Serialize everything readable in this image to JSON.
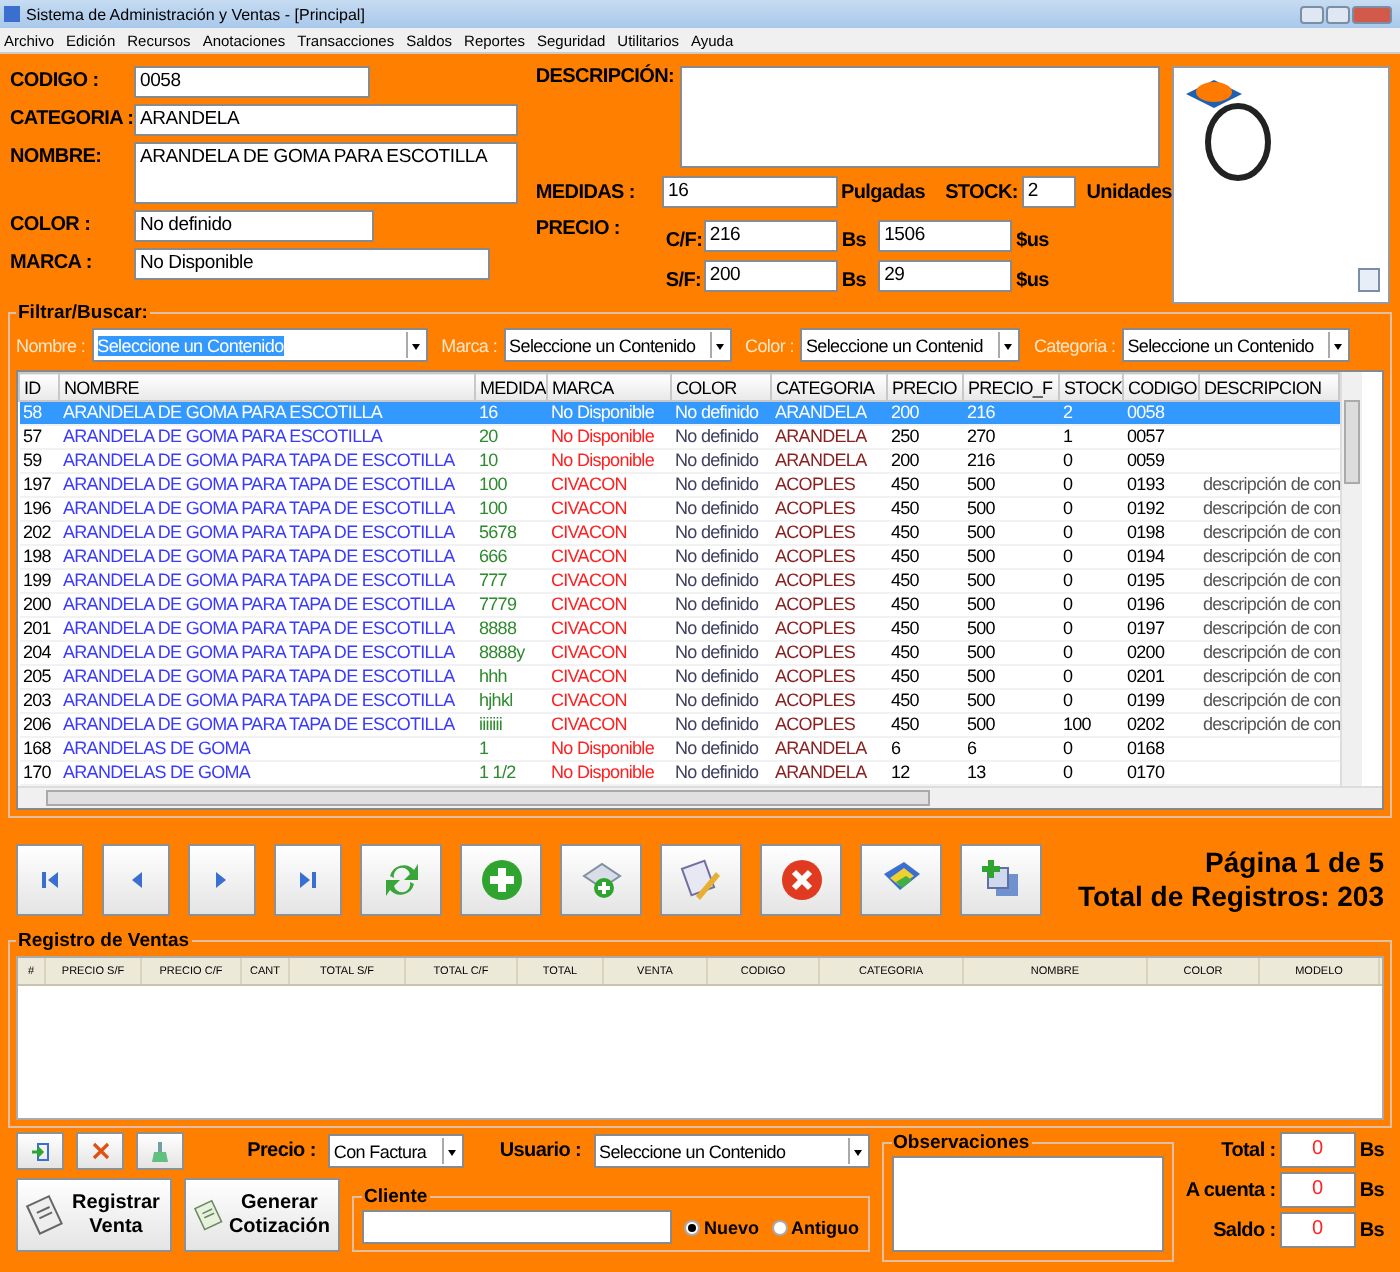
{
  "window": {
    "title": "Sistema de Administración y Ventas - [Principal]"
  },
  "menu": [
    "Archivo",
    "Edición",
    "Recursos",
    "Anotaciones",
    "Transacciones",
    "Saldos",
    "Reportes",
    "Seguridad",
    "Utilitarios",
    "Ayuda"
  ],
  "product": {
    "codigo": {
      "label": "CODIGO :",
      "value": "0058"
    },
    "categoria": {
      "label": "CATEGORIA :",
      "value": "ARANDELA"
    },
    "nombre": {
      "label": "NOMBRE:",
      "value": "ARANDELA DE GOMA PARA ESCOTILLA"
    },
    "color": {
      "label": "COLOR :",
      "value": "No definido"
    },
    "marca": {
      "label": "MARCA :",
      "value": "No Disponible"
    },
    "descripcion": {
      "label": "DESCRIPCIÓN:"
    },
    "medidas": {
      "label": "MEDIDAS :",
      "value": "16",
      "unit": "Pulgadas"
    },
    "stock": {
      "label": "STOCK:",
      "value": "2",
      "unit": "Unidades"
    },
    "precio": {
      "label": "PRECIO :",
      "rows": [
        {
          "label": "C/F:",
          "bs": "216",
          "bs_unit": "Bs",
          "us": "1506",
          "us_unit": "$us"
        },
        {
          "label": "S/F:",
          "bs": "200",
          "bs_unit": "Bs",
          "us": "29",
          "us_unit": "$us"
        }
      ]
    }
  },
  "filter": {
    "title": "Filtrar/Buscar:",
    "fields": [
      {
        "label": "Nombre :",
        "value": "Seleccione un Contenido",
        "highlighted": true
      },
      {
        "label": "Marca :",
        "value": "Seleccione un Contenido",
        "highlighted": false
      },
      {
        "label": "Color :",
        "value": "Seleccione un Contenid",
        "highlighted": false
      },
      {
        "label": "Categoria :",
        "value": "Seleccione un Contenido",
        "highlighted": false
      }
    ]
  },
  "table": {
    "columns": [
      "ID",
      "NOMBRE",
      "MEDIDA",
      "MARCA",
      "COLOR",
      "CATEGORIA",
      "PRECIO",
      "PRECIO_F",
      "STOCK",
      "CODIGO",
      "DESCRIPCION"
    ],
    "rows": [
      {
        "selected": true,
        "cells": [
          "58",
          "ARANDELA DE GOMA PARA ESCOTILLA",
          "16",
          "No Disponible",
          "No definido",
          "ARANDELA",
          "200",
          "216",
          "2",
          "0058"
        ]
      },
      {
        "selected": false,
        "cells": [
          "57",
          "ARANDELA DE GOMA PARA ESCOTILLA",
          "20",
          "No Disponible",
          "No definido",
          "ARANDELA",
          "250",
          "270",
          "1",
          "0057"
        ]
      },
      {
        "selected": false,
        "cells": [
          "59",
          "ARANDELA DE GOMA PARA TAPA DE ESCOTILLA",
          "10",
          "No Disponible",
          "No definido",
          "ARANDELA",
          "200",
          "216",
          "0",
          "0059"
        ]
      },
      {
        "selected": false,
        "cells": [
          "197",
          "ARANDELA DE GOMA PARA TAPA DE ESCOTILLA",
          "100",
          "CIVACON",
          "No definido",
          "ACOPLES",
          "450",
          "500",
          "0",
          "0193",
          "descripción de con"
        ]
      },
      {
        "selected": false,
        "cells": [
          "196",
          "ARANDELA DE GOMA PARA TAPA DE ESCOTILLA",
          "100",
          "CIVACON",
          "No definido",
          "ACOPLES",
          "450",
          "500",
          "0",
          "0192",
          "descripción de con"
        ]
      },
      {
        "selected": false,
        "cells": [
          "202",
          "ARANDELA DE GOMA PARA TAPA DE ESCOTILLA",
          "5678",
          "CIVACON",
          "No definido",
          "ACOPLES",
          "450",
          "500",
          "0",
          "0198",
          "descripción de con"
        ]
      },
      {
        "selected": false,
        "cells": [
          "198",
          "ARANDELA DE GOMA PARA TAPA DE ESCOTILLA",
          "666",
          "CIVACON",
          "No definido",
          "ACOPLES",
          "450",
          "500",
          "0",
          "0194",
          "descripción de con"
        ]
      },
      {
        "selected": false,
        "cells": [
          "199",
          "ARANDELA DE GOMA PARA TAPA DE ESCOTILLA",
          "777",
          "CIVACON",
          "No definido",
          "ACOPLES",
          "450",
          "500",
          "0",
          "0195",
          "descripción de con"
        ]
      },
      {
        "selected": false,
        "cells": [
          "200",
          "ARANDELA DE GOMA PARA TAPA DE ESCOTILLA",
          "7779",
          "CIVACON",
          "No definido",
          "ACOPLES",
          "450",
          "500",
          "0",
          "0196",
          "descripción de con"
        ]
      },
      {
        "selected": false,
        "cells": [
          "201",
          "ARANDELA DE GOMA PARA TAPA DE ESCOTILLA",
          "8888",
          "CIVACON",
          "No definido",
          "ACOPLES",
          "450",
          "500",
          "0",
          "0197",
          "descripción de con"
        ]
      },
      {
        "selected": false,
        "cells": [
          "204",
          "ARANDELA DE GOMA PARA TAPA DE ESCOTILLA",
          "8888y",
          "CIVACON",
          "No definido",
          "ACOPLES",
          "450",
          "500",
          "0",
          "0200",
          "descripción de con"
        ]
      },
      {
        "selected": false,
        "cells": [
          "205",
          "ARANDELA DE GOMA PARA TAPA DE ESCOTILLA",
          "hhh",
          "CIVACON",
          "No definido",
          "ACOPLES",
          "450",
          "500",
          "0",
          "0201",
          "descripción de con"
        ]
      },
      {
        "selected": false,
        "cells": [
          "203",
          "ARANDELA DE GOMA PARA TAPA DE ESCOTILLA",
          "hjhkl",
          "CIVACON",
          "No definido",
          "ACOPLES",
          "450",
          "500",
          "0",
          "0199",
          "descripción de con"
        ]
      },
      {
        "selected": false,
        "cells": [
          "206",
          "ARANDELA DE GOMA PARA TAPA DE ESCOTILLA",
          "iiiiiii",
          "CIVACON",
          "No definido",
          "ACOPLES",
          "450",
          "500",
          "100",
          "0202",
          "descripción de con"
        ]
      },
      {
        "selected": false,
        "cells": [
          "168",
          "ARANDELAS DE GOMA",
          "1",
          "No Disponible",
          "No definido",
          "ARANDELA",
          "6",
          "6",
          "0",
          "0168"
        ]
      },
      {
        "selected": false,
        "cells": [
          "170",
          "ARANDELAS DE GOMA",
          "1 1/2",
          "No Disponible",
          "No definido",
          "ARANDELA",
          "12",
          "13",
          "0",
          "0170"
        ]
      }
    ]
  },
  "toolbar": [
    {
      "kind": "first"
    },
    {
      "kind": "prev"
    },
    {
      "kind": "next"
    },
    {
      "kind": "last"
    },
    {
      "kind": "refresh"
    },
    {
      "kind": "add"
    },
    {
      "kind": "add-item"
    },
    {
      "kind": "edit"
    },
    {
      "kind": "delete"
    },
    {
      "kind": "stack"
    },
    {
      "kind": "copy-add"
    }
  ],
  "pager": {
    "page": "Página 1 de 5",
    "total": "Total de Registros: 203"
  },
  "ventas": {
    "title": "Registro de Ventas",
    "columns": [
      "#",
      "PRECIO S/F",
      "PRECIO C/F",
      "CANT",
      "TOTAL S/F",
      "TOTAL C/F",
      "TOTAL",
      "VENTA",
      "CODIGO",
      "CATEGORIA",
      "NOMBRE",
      "COLOR",
      "MODELO"
    ]
  },
  "small_buttons": [
    {
      "kind": "enter"
    },
    {
      "kind": "remove"
    },
    {
      "kind": "clear"
    }
  ],
  "precio": {
    "label": "Precio :",
    "value": "Con Factura"
  },
  "usuario": {
    "label": "Usuario :",
    "value": "Seleccione un Contenido"
  },
  "actions": [
    {
      "kind": "register",
      "label": "Registrar Venta"
    },
    {
      "kind": "quote",
      "label": "Generar Cotización"
    }
  ],
  "cliente": {
    "title": "Cliente",
    "options": [
      {
        "label": "Nuevo",
        "selected": true
      },
      {
        "label": "Antiguo",
        "selected": false
      }
    ]
  },
  "observaciones": {
    "title": "Observaciones"
  },
  "totals": [
    {
      "label": "Total :",
      "value": "0",
      "unit": "Bs"
    },
    {
      "label": "A cuenta :",
      "value": "0",
      "unit": "Bs"
    },
    {
      "label": "Saldo :",
      "value": "0",
      "unit": "Bs"
    }
  ]
}
